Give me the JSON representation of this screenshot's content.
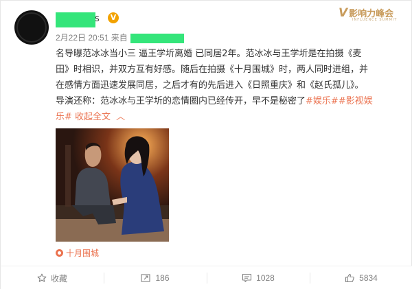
{
  "post": {
    "author_suffix": "s",
    "verified_badge": "V",
    "date": "2月22日",
    "time": "20:51",
    "source_label": "来自",
    "text_lines": [
      "名导曝范冰冰当小三 逼王学圻离婚 已同居2年。范冰冰与王学圻是在拍摄《麦",
      "田》时相识，并双方互有好感。随后在拍摄《十月围城》时，两人同时进组，并",
      "在感情方面迅速发展同居，之后才有的先后进入《日照重庆》和《赵氏孤儿》。",
      "导演还称：范冰冰与王学圻的恋情圈内已经传开，早不是秘密了"
    ],
    "hashtag_1": "#娱乐#",
    "hashtag_2_part1": "#影视娱",
    "hashtag_2_part2": "乐#",
    "collapse_label": "收起全文",
    "collapse_icon": "chevron-up-icon",
    "location": "十月围城"
  },
  "watermark": {
    "text": "影响力峰会",
    "sub": "INFLUENCE SUMMIT"
  },
  "actions": {
    "favorite_label": "收藏",
    "repost_count": "186",
    "comment_count": "1028",
    "like_count": "5834"
  },
  "colors": {
    "link": "#eb7350",
    "redacted": "#34e57a",
    "badge": "#f2a200",
    "muted": "#808080"
  }
}
